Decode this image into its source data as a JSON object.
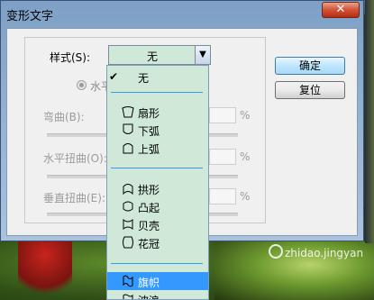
{
  "window": {
    "title": "变形文字",
    "close_symbol": "✕"
  },
  "form": {
    "style_label": "样式(S):",
    "style_value": "无",
    "radio_label": "水平",
    "bend_label": "弯曲(B):",
    "hdistort_label": "水平扭曲(O):",
    "vdistort_label": "垂直扭曲(E):",
    "percent": "%"
  },
  "buttons": {
    "ok": "确定",
    "reset": "复位"
  },
  "dropdown": {
    "items": [
      {
        "label": "无",
        "checked": true,
        "selected": false
      },
      {
        "label": "扇形",
        "icon": "arc-fan-icon"
      },
      {
        "label": "下弧",
        "icon": "arc-lower-icon"
      },
      {
        "label": "上弧",
        "icon": "arc-upper-icon"
      },
      {
        "label": "拱形",
        "icon": "arch-icon"
      },
      {
        "label": "凸起",
        "icon": "bulge-icon"
      },
      {
        "label": "贝壳",
        "icon": "shell-icon"
      },
      {
        "label": "花冠",
        "icon": "flower-icon"
      },
      {
        "label": "旗帜",
        "icon": "flag-icon",
        "selected": true
      },
      {
        "label": "波浪",
        "icon": "wave-icon"
      }
    ],
    "check_symbol": "✔",
    "selection_color": "#3399ff"
  },
  "watermark": {
    "text": "zhidao.jingyan"
  }
}
